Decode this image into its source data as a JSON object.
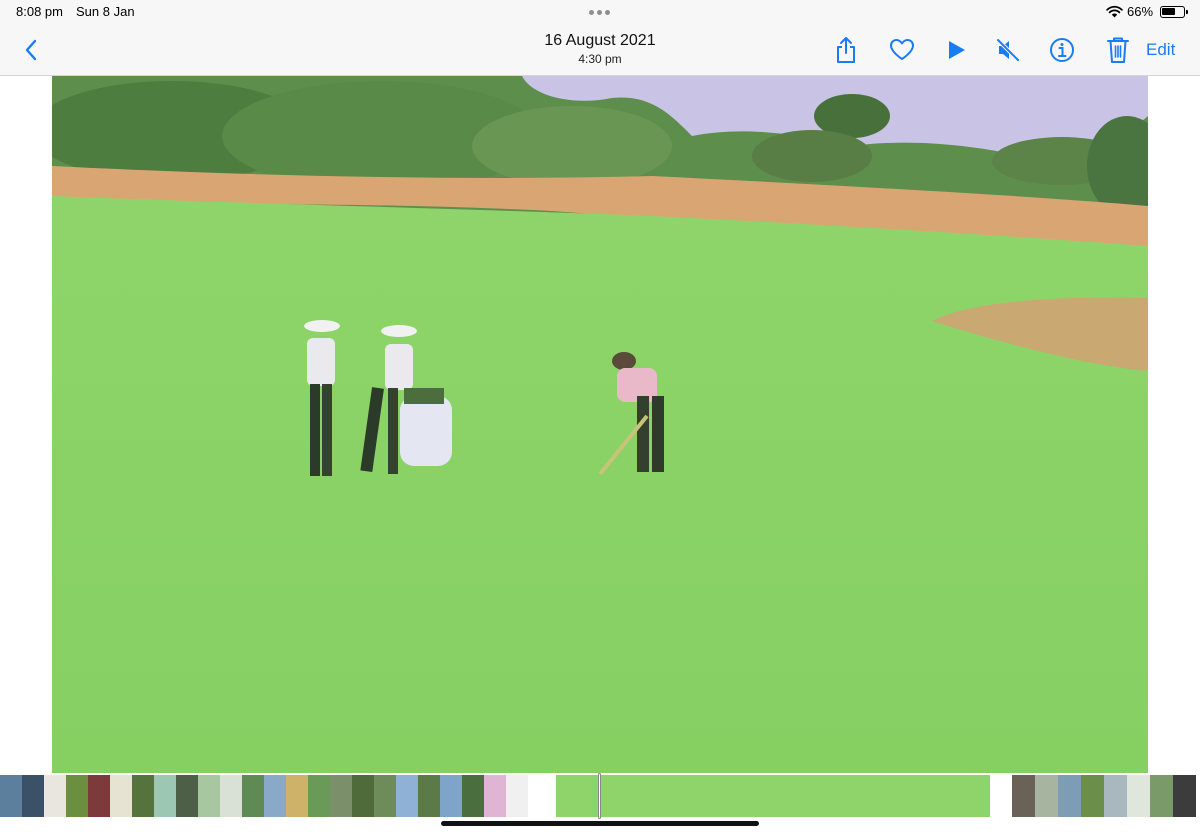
{
  "status_bar": {
    "time": "8:08 pm",
    "date": "Sun 8 Jan",
    "battery_percent_text": "66%",
    "battery_level": 0.66
  },
  "nav": {
    "title": "16 August 2021",
    "subtitle": "4:30 pm",
    "edit_label": "Edit",
    "accent_color": "#1a7cf5",
    "icons": [
      "back-chevron-icon",
      "share-icon",
      "heart-icon",
      "play-icon",
      "mute-icon",
      "info-icon",
      "trash-icon"
    ]
  },
  "media": {
    "type": "video",
    "scene": "golf-fairway"
  },
  "scrubber": {
    "position_fraction": 0.5
  }
}
